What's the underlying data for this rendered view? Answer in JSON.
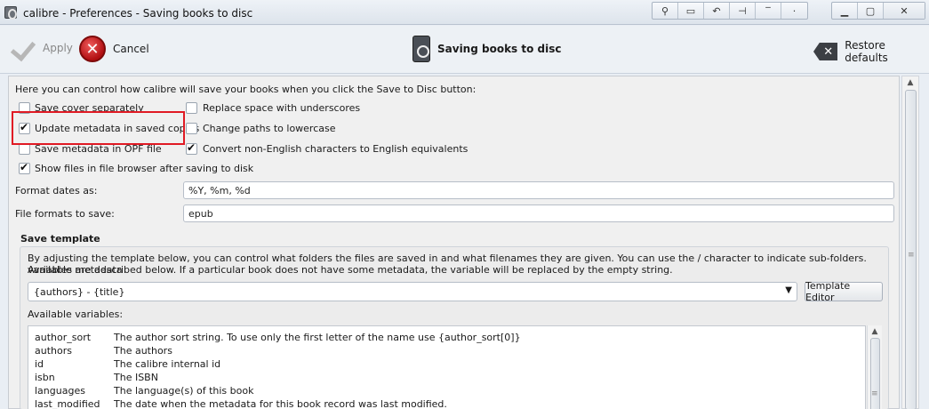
{
  "window": {
    "title": "calibre - Preferences - Saving books to disc",
    "wm_buttons": [
      "pin-icon",
      "window-icon",
      "rollback-icon",
      "keep-icon",
      "shade-icon",
      "dot-icon"
    ],
    "controls": [
      "minimize-icon",
      "maximize-icon",
      "close-icon"
    ]
  },
  "toolbar": {
    "apply_label": "Apply",
    "cancel_label": "Cancel",
    "section_title": "Saving books to disc",
    "restore_label": "Restore defaults"
  },
  "options": {
    "intro": "Here you can control how calibre will save your books when you click the Save to Disc button:",
    "save_cover": "Save cover separately",
    "update_metadata": "Update metadata in saved copies",
    "save_opf": "Save metadata in OPF file",
    "show_files": "Show files in file browser after saving to disk",
    "replace_space": "Replace space with underscores",
    "lowercase": "Change paths to lowercase",
    "convert_ascii": "Convert non-English characters to English equivalents",
    "format_dates_label": "Format dates as:",
    "format_dates_value": "%Y, %m, %d",
    "formats_label": "File formats to save:",
    "formats_value": "epub",
    "checked": {
      "save_cover": false,
      "update_metadata": true,
      "save_opf": false,
      "show_files": true,
      "replace_space": false,
      "lowercase": false,
      "convert_ascii": true
    }
  },
  "template": {
    "group_title": "Save template",
    "description_line1": "By adjusting the template below, you can control what folders the files are saved in and what filenames they are given. You can use the / character to indicate sub-folders. Available metadata",
    "description_line2": "variables are described below. If a particular book does not have some metadata, the variable will be replaced by the empty string.",
    "value": "{authors} - {title}",
    "editor_button": "Template Editor",
    "vars_label": "Available variables:",
    "variables": [
      {
        "name": "author_sort",
        "desc": "The author sort string. To use only the first letter of the name use {author_sort[0]}"
      },
      {
        "name": "authors",
        "desc": "The authors"
      },
      {
        "name": "id",
        "desc": "The calibre internal id"
      },
      {
        "name": "isbn",
        "desc": "The ISBN"
      },
      {
        "name": "languages",
        "desc": "The language(s) of this book"
      },
      {
        "name": "last_modified",
        "desc": "The date when the metadata for this book record was last modified."
      }
    ]
  },
  "colors": {
    "highlight": "#e01a24",
    "cancel_red": "#b10f12"
  }
}
